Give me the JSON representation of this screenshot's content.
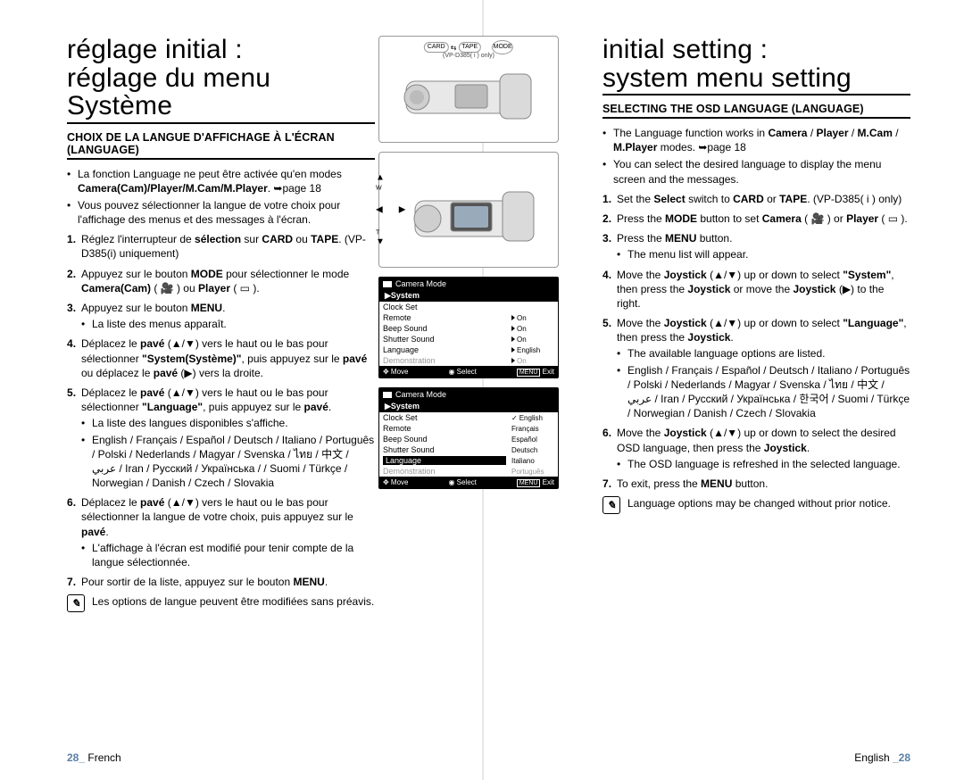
{
  "left": {
    "title": "réglage initial :\nréglage du menu Système",
    "section": "CHOIX DE LA LANGUE D'AFFICHAGE À L'ÉCRAN (LANGUAGE)",
    "intro": [
      "La fonction Language ne peut être activée qu'en modes <b>Camera(Cam)/Player/M.Cam/M.Player</b>. ➥page 18",
      "Vous pouvez sélectionner la langue de votre choix pour l'affichage des menus et des messages à l'écran."
    ],
    "steps": [
      {
        "t": "Réglez l'interrupteur de <b>sélection</b> sur <b>CARD</b> ou <b>TAPE</b>. (VP-D385(i) uniquement)"
      },
      {
        "t": "Appuyez sur le bouton <b>MODE</b> pour sélectionner le mode <b>Camera(Cam)</b> ( 🎥 ) ou <b>Player</b> ( ▭ )."
      },
      {
        "t": "Appuyez sur le bouton <b>MENU</b>.",
        "sub": [
          "La liste des menus apparaît."
        ]
      },
      {
        "t": "Déplacez le <b>pavé</b> (▲/▼) vers le haut ou le bas pour sélectionner <b>\"System(Système)\"</b>, puis appuyez sur le <b>pavé</b> ou déplacez le <b>pavé</b> (▶) vers la droite."
      },
      {
        "t": "Déplacez le <b>pavé</b> (▲/▼) vers le haut ou le bas pour sélectionner <b>\"Language\"</b>, puis appuyez sur le <b>pavé</b>.",
        "sub": [
          "La liste des langues disponibles s'affiche.",
          "English / Français / Español / Deutsch / Italiano / Português / Polski / Nederlands / Magyar / Svenska / ไทย / 中文 / ﻋﺮﺑﻲ / Iran / Русский / Українська / / Suomi / Türkçe / Norwegian / Danish / Czech / Slovakia"
        ]
      },
      {
        "t": "Déplacez le <b>pavé</b> (▲/▼) vers le haut ou le bas pour sélectionner la langue de votre choix, puis appuyez sur le <b>pavé</b>.",
        "sub": [
          "L'affichage à l'écran est modifié pour tenir compte de la langue sélectionnée."
        ]
      },
      {
        "t": "Pour sortir de la liste, appuyez sur le bouton <b>MENU</b>."
      }
    ],
    "note": "Les options de langue peuvent être modifiées sans préavis.",
    "pagenum_n": "28_",
    "pagenum_t": " French"
  },
  "right": {
    "title": "initial setting :\nsystem menu setting",
    "section": "SELECTING THE OSD LANGUAGE (LANGUAGE)",
    "intro": [
      "The Language function works in <b>Camera</b> / <b>Player</b> / <b>M.Cam</b> / <b>M.Player</b> modes. ➥page 18",
      "You can select the desired language to display the menu screen and the messages."
    ],
    "steps": [
      {
        "t": "Set the <b>Select</b> switch to <b>CARD</b> or <b>TAPE</b>. (VP-D385( i ) only)"
      },
      {
        "t": "Press the <b>MODE</b> button to set <b>Camera</b> ( 🎥 ) or <b>Player</b> ( ▭ )."
      },
      {
        "t": "Press the <b>MENU</b> button.",
        "sub": [
          "The menu list will appear."
        ]
      },
      {
        "t": "Move the <b>Joystick</b> (▲/▼) up or down to select <b>\"System\"</b>, then press the <b>Joystick</b> or move the <b>Joystick</b> (▶) to the right."
      },
      {
        "t": "Move the <b>Joystick</b> (▲/▼) up or down to select <b>\"Language\"</b>, then press the <b>Joystick</b>.",
        "sub": [
          "The available language options are listed.",
          "English / Français / Español / Deutsch / Italiano / Português / Polski / Nederlands / Magyar / Svenska / ไทย / 中文 / ﻋﺮﺑﻲ / Iran / Русский / Українська / 한국어 / Suomi / Türkçe / Norwegian / Danish / Czech / Slovakia"
        ]
      },
      {
        "t": "Move the <b>Joystick</b> (▲/▼) up or down to select the desired OSD language, then press the <b>Joystick</b>.",
        "sub": [
          "The OSD language is refreshed in the selected language."
        ]
      },
      {
        "t": "To exit, press the <b>MENU</b> button."
      }
    ],
    "note": "Language options may be changed without prior notice.",
    "pagenum_t": "English ",
    "pagenum_n": "_28"
  },
  "center": {
    "card": "CARD",
    "tape": "TAPE",
    "mode": "MODE",
    "vp": "(VP-D385( i ) only)",
    "lcd1": {
      "hdr": "Camera Mode",
      "group": "▶System",
      "rows": [
        {
          "n": "Clock Set",
          "v": ""
        },
        {
          "n": "Remote",
          "v": "On",
          "arrow": true
        },
        {
          "n": "Beep Sound",
          "v": "On",
          "arrow": true
        },
        {
          "n": "Shutter Sound",
          "v": "On",
          "arrow": true
        },
        {
          "n": "Language",
          "v": "English",
          "arrow": true
        },
        {
          "n": "Demonstration",
          "v": "On",
          "arrow": true,
          "dim": true
        }
      ],
      "ftr": {
        "move": "Move",
        "select": "Select",
        "menu": "MENU",
        "exit": "Exit"
      }
    },
    "lcd2": {
      "hdr": "Camera Mode",
      "group": "▶System",
      "rows": [
        {
          "n": "Clock Set",
          "v": "English",
          "check": true
        },
        {
          "n": "Remote",
          "v": "Français"
        },
        {
          "n": "Beep Sound",
          "v": "Español"
        },
        {
          "n": "Shutter Sound",
          "v": "Deutsch"
        },
        {
          "n": "Language",
          "v": "Italiano",
          "sel": true
        },
        {
          "n": "Demonstration",
          "v": "Português",
          "dim": true
        }
      ],
      "ftr": {
        "move": "Move",
        "select": "Select",
        "menu": "MENU",
        "exit": "Exit"
      }
    }
  }
}
